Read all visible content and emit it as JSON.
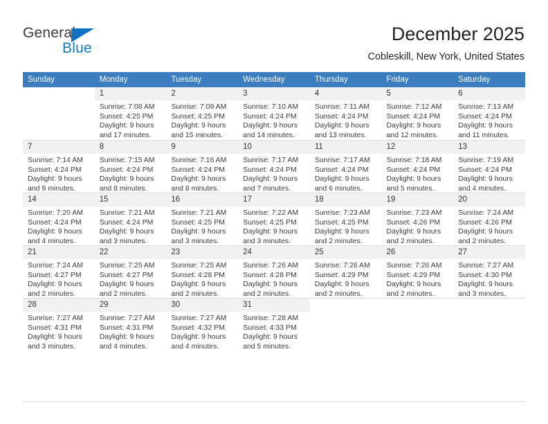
{
  "brand": {
    "name_part1": "General",
    "name_part2": "Blue",
    "triangle_color": "#0d72c4",
    "text_color_primary": "#3b3b3b",
    "text_color_secondary": "#1778c2"
  },
  "header": {
    "title": "December 2025",
    "subtitle": "Cobleskill, New York, United States"
  },
  "theme": {
    "header_row_bg": "#3b7dbf",
    "daynum_bg": "#f1f1f1",
    "grid_line": "#dcdcdc"
  },
  "weekday_headers": [
    "Sunday",
    "Monday",
    "Tuesday",
    "Wednesday",
    "Thursday",
    "Friday",
    "Saturday"
  ],
  "labels": {
    "sunrise_prefix": "Sunrise:",
    "sunset_prefix": "Sunset:",
    "daylight_prefix": "Daylight:"
  },
  "weeks": [
    [
      {
        "day": "",
        "sunrise": "",
        "sunset": "",
        "daylight_a": "",
        "daylight_b": ""
      },
      {
        "day": "1",
        "sunrise": "Sunrise: 7:08 AM",
        "sunset": "Sunset: 4:25 PM",
        "daylight_a": "Daylight: 9 hours",
        "daylight_b": "and 17 minutes."
      },
      {
        "day": "2",
        "sunrise": "Sunrise: 7:09 AM",
        "sunset": "Sunset: 4:25 PM",
        "daylight_a": "Daylight: 9 hours",
        "daylight_b": "and 15 minutes."
      },
      {
        "day": "3",
        "sunrise": "Sunrise: 7:10 AM",
        "sunset": "Sunset: 4:24 PM",
        "daylight_a": "Daylight: 9 hours",
        "daylight_b": "and 14 minutes."
      },
      {
        "day": "4",
        "sunrise": "Sunrise: 7:11 AM",
        "sunset": "Sunset: 4:24 PM",
        "daylight_a": "Daylight: 9 hours",
        "daylight_b": "and 13 minutes."
      },
      {
        "day": "5",
        "sunrise": "Sunrise: 7:12 AM",
        "sunset": "Sunset: 4:24 PM",
        "daylight_a": "Daylight: 9 hours",
        "daylight_b": "and 12 minutes."
      },
      {
        "day": "6",
        "sunrise": "Sunrise: 7:13 AM",
        "sunset": "Sunset: 4:24 PM",
        "daylight_a": "Daylight: 9 hours",
        "daylight_b": "and 11 minutes."
      }
    ],
    [
      {
        "day": "7",
        "sunrise": "Sunrise: 7:14 AM",
        "sunset": "Sunset: 4:24 PM",
        "daylight_a": "Daylight: 9 hours",
        "daylight_b": "and 9 minutes."
      },
      {
        "day": "8",
        "sunrise": "Sunrise: 7:15 AM",
        "sunset": "Sunset: 4:24 PM",
        "daylight_a": "Daylight: 9 hours",
        "daylight_b": "and 8 minutes."
      },
      {
        "day": "9",
        "sunrise": "Sunrise: 7:16 AM",
        "sunset": "Sunset: 4:24 PM",
        "daylight_a": "Daylight: 9 hours",
        "daylight_b": "and 8 minutes."
      },
      {
        "day": "10",
        "sunrise": "Sunrise: 7:17 AM",
        "sunset": "Sunset: 4:24 PM",
        "daylight_a": "Daylight: 9 hours",
        "daylight_b": "and 7 minutes."
      },
      {
        "day": "11",
        "sunrise": "Sunrise: 7:17 AM",
        "sunset": "Sunset: 4:24 PM",
        "daylight_a": "Daylight: 9 hours",
        "daylight_b": "and 6 minutes."
      },
      {
        "day": "12",
        "sunrise": "Sunrise: 7:18 AM",
        "sunset": "Sunset: 4:24 PM",
        "daylight_a": "Daylight: 9 hours",
        "daylight_b": "and 5 minutes."
      },
      {
        "day": "13",
        "sunrise": "Sunrise: 7:19 AM",
        "sunset": "Sunset: 4:24 PM",
        "daylight_a": "Daylight: 9 hours",
        "daylight_b": "and 4 minutes."
      }
    ],
    [
      {
        "day": "14",
        "sunrise": "Sunrise: 7:20 AM",
        "sunset": "Sunset: 4:24 PM",
        "daylight_a": "Daylight: 9 hours",
        "daylight_b": "and 4 minutes."
      },
      {
        "day": "15",
        "sunrise": "Sunrise: 7:21 AM",
        "sunset": "Sunset: 4:24 PM",
        "daylight_a": "Daylight: 9 hours",
        "daylight_b": "and 3 minutes."
      },
      {
        "day": "16",
        "sunrise": "Sunrise: 7:21 AM",
        "sunset": "Sunset: 4:25 PM",
        "daylight_a": "Daylight: 9 hours",
        "daylight_b": "and 3 minutes."
      },
      {
        "day": "17",
        "sunrise": "Sunrise: 7:22 AM",
        "sunset": "Sunset: 4:25 PM",
        "daylight_a": "Daylight: 9 hours",
        "daylight_b": "and 3 minutes."
      },
      {
        "day": "18",
        "sunrise": "Sunrise: 7:23 AM",
        "sunset": "Sunset: 4:25 PM",
        "daylight_a": "Daylight: 9 hours",
        "daylight_b": "and 2 minutes."
      },
      {
        "day": "19",
        "sunrise": "Sunrise: 7:23 AM",
        "sunset": "Sunset: 4:26 PM",
        "daylight_a": "Daylight: 9 hours",
        "daylight_b": "and 2 minutes."
      },
      {
        "day": "20",
        "sunrise": "Sunrise: 7:24 AM",
        "sunset": "Sunset: 4:26 PM",
        "daylight_a": "Daylight: 9 hours",
        "daylight_b": "and 2 minutes."
      }
    ],
    [
      {
        "day": "21",
        "sunrise": "Sunrise: 7:24 AM",
        "sunset": "Sunset: 4:27 PM",
        "daylight_a": "Daylight: 9 hours",
        "daylight_b": "and 2 minutes."
      },
      {
        "day": "22",
        "sunrise": "Sunrise: 7:25 AM",
        "sunset": "Sunset: 4:27 PM",
        "daylight_a": "Daylight: 9 hours",
        "daylight_b": "and 2 minutes."
      },
      {
        "day": "23",
        "sunrise": "Sunrise: 7:25 AM",
        "sunset": "Sunset: 4:28 PM",
        "daylight_a": "Daylight: 9 hours",
        "daylight_b": "and 2 minutes."
      },
      {
        "day": "24",
        "sunrise": "Sunrise: 7:26 AM",
        "sunset": "Sunset: 4:28 PM",
        "daylight_a": "Daylight: 9 hours",
        "daylight_b": "and 2 minutes."
      },
      {
        "day": "25",
        "sunrise": "Sunrise: 7:26 AM",
        "sunset": "Sunset: 4:29 PM",
        "daylight_a": "Daylight: 9 hours",
        "daylight_b": "and 2 minutes."
      },
      {
        "day": "26",
        "sunrise": "Sunrise: 7:26 AM",
        "sunset": "Sunset: 4:29 PM",
        "daylight_a": "Daylight: 9 hours",
        "daylight_b": "and 2 minutes."
      },
      {
        "day": "27",
        "sunrise": "Sunrise: 7:27 AM",
        "sunset": "Sunset: 4:30 PM",
        "daylight_a": "Daylight: 9 hours",
        "daylight_b": "and 3 minutes."
      }
    ],
    [
      {
        "day": "28",
        "sunrise": "Sunrise: 7:27 AM",
        "sunset": "Sunset: 4:31 PM",
        "daylight_a": "Daylight: 9 hours",
        "daylight_b": "and 3 minutes."
      },
      {
        "day": "29",
        "sunrise": "Sunrise: 7:27 AM",
        "sunset": "Sunset: 4:31 PM",
        "daylight_a": "Daylight: 9 hours",
        "daylight_b": "and 4 minutes."
      },
      {
        "day": "30",
        "sunrise": "Sunrise: 7:27 AM",
        "sunset": "Sunset: 4:32 PM",
        "daylight_a": "Daylight: 9 hours",
        "daylight_b": "and 4 minutes."
      },
      {
        "day": "31",
        "sunrise": "Sunrise: 7:28 AM",
        "sunset": "Sunset: 4:33 PM",
        "daylight_a": "Daylight: 9 hours",
        "daylight_b": "and 5 minutes."
      },
      {
        "day": "",
        "sunrise": "",
        "sunset": "",
        "daylight_a": "",
        "daylight_b": ""
      },
      {
        "day": "",
        "sunrise": "",
        "sunset": "",
        "daylight_a": "",
        "daylight_b": ""
      },
      {
        "day": "",
        "sunrise": "",
        "sunset": "",
        "daylight_a": "",
        "daylight_b": ""
      }
    ]
  ]
}
